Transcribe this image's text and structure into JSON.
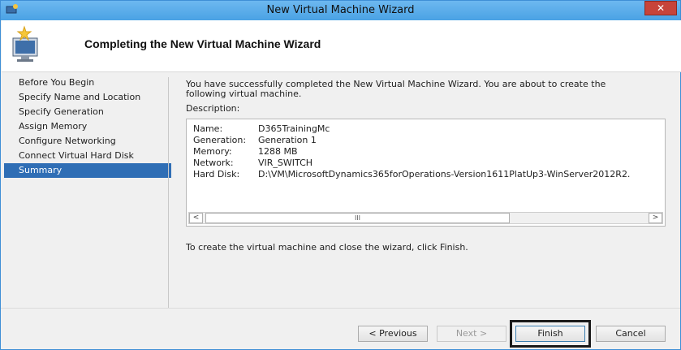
{
  "window": {
    "title": "New Virtual Machine Wizard",
    "close_label": "✕"
  },
  "header": {
    "title": "Completing the New Virtual Machine Wizard"
  },
  "nav": {
    "items": [
      {
        "label": "Before You Begin"
      },
      {
        "label": "Specify Name and Location"
      },
      {
        "label": "Specify Generation"
      },
      {
        "label": "Assign Memory"
      },
      {
        "label": "Configure Networking"
      },
      {
        "label": "Connect Virtual Hard Disk"
      },
      {
        "label": "Summary"
      }
    ],
    "active_index": 6
  },
  "content": {
    "intro_line1": "You have successfully completed the New Virtual Machine Wizard. You are about to create the",
    "intro_line2": "following virtual machine.",
    "description_label": "Description:",
    "summary": [
      {
        "key": "Name:",
        "value": "D365TrainingMc"
      },
      {
        "key": "Generation:",
        "value": "Generation 1"
      },
      {
        "key": "Memory:",
        "value": "1288 MB"
      },
      {
        "key": "Network:",
        "value": "VIR_SWITCH"
      },
      {
        "key": "Hard Disk:",
        "value": "D:\\VM\\MicrosoftDynamics365forOperations-Version1611PlatUp3-WinServer2012R2."
      }
    ],
    "scroll_left": "<",
    "scroll_right": ">",
    "scroll_thumb": "III",
    "finish_hint": "To create the virtual machine and close the wizard, click Finish."
  },
  "footer": {
    "previous_label": "< Previous",
    "next_label": "Next >",
    "finish_label": "Finish",
    "cancel_label": "Cancel"
  },
  "colors": {
    "titlebar": "#4aa2e4",
    "active_nav": "#2f6eb5",
    "close_button": "#c7443a"
  }
}
